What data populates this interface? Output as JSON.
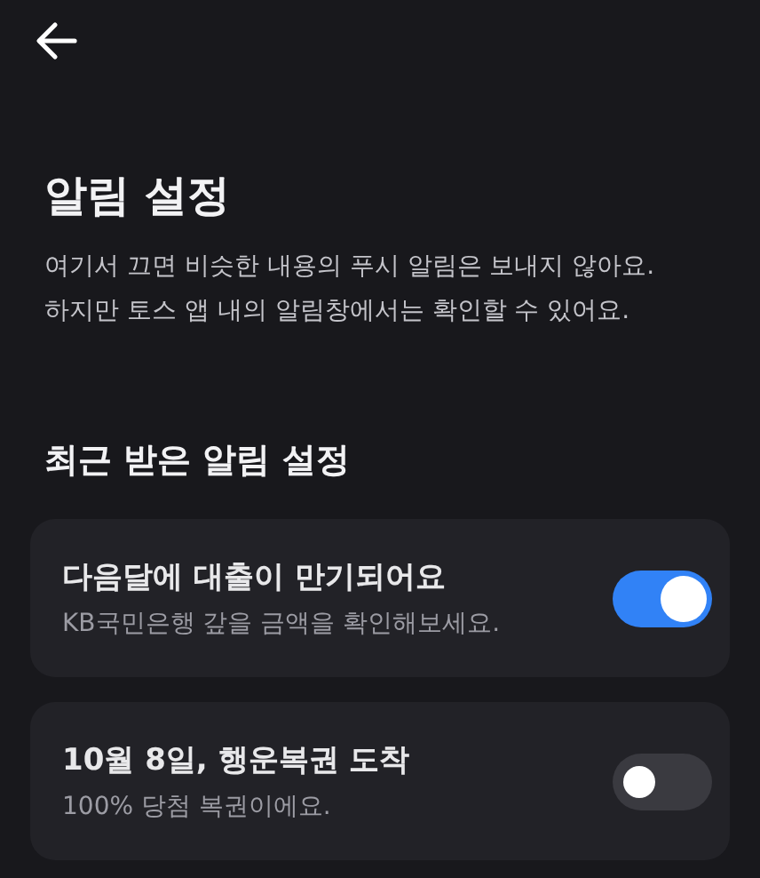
{
  "header": {
    "back": true
  },
  "title": "알림 설정",
  "description": [
    "여기서 끄면 비슷한 내용의 푸시 알림은 보내지 않아요.",
    "하지만 토스 앱 내의 알림창에서는 확인할 수 있어요."
  ],
  "section": {
    "title": "최근 받은 알림 설정",
    "items": [
      {
        "title": "다음달에 대출이 만기되어요",
        "subtitle": "KB국민은행 갚을 금액을 확인해보세요.",
        "on": true
      },
      {
        "title": "10월 8일, 행운복권 도착",
        "subtitle": "100% 당첨 복권이에요.",
        "on": false
      }
    ]
  }
}
